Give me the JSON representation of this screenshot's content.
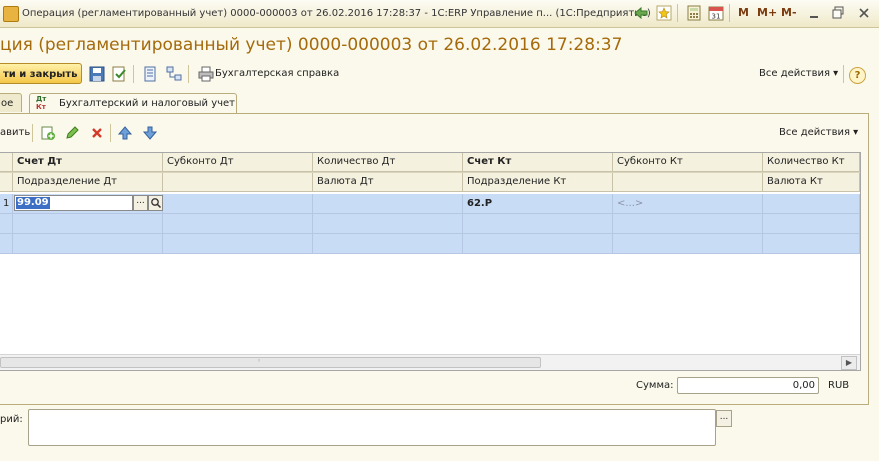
{
  "window": {
    "title": "Операция (регламентированный учет) 0000-000003 от 26.02.2016 17:28:37 - 1С:ERP Управление п...  (1С:Предприятие)",
    "memory_buttons": [
      "M",
      "M+",
      "M-"
    ]
  },
  "document": {
    "title": "ция (регламентированный учет) 0000-000003 от 26.02.2016 17:28:37"
  },
  "toolbar": {
    "post_close_label": "ти и закрыть",
    "accounting_report_label": "Бухгалтерская справка",
    "all_actions_label": "Все действия ▾",
    "help_label": "?"
  },
  "tabs": [
    {
      "label": "ое"
    },
    {
      "label": "Бухгалтерский и налоговый учет",
      "icon_top": "Дт",
      "icon_bottom": "Кт"
    }
  ],
  "table_toolbar": {
    "add_label": "авить",
    "all_actions_label": "Все действия ▾"
  },
  "table": {
    "header_row1": [
      "Счет Дт",
      "Субконто Дт",
      "Количество Дт",
      "Счет Кт",
      "Субконто Кт",
      "Количество Кт"
    ],
    "header_row2": [
      "Подразделение Дт",
      "",
      "Валюта Дт",
      "Подразделение Кт",
      "",
      "Валюта Кт"
    ],
    "rows": [
      {
        "num": "1",
        "account_dt": "99.09",
        "account_kt": "62.Р",
        "subconto_kt": "<...>"
      }
    ]
  },
  "footer": {
    "sum_label": "Сумма:",
    "sum_value": "0,00",
    "currency": "RUB",
    "comment_label": "рий:",
    "comment_value": ""
  }
}
